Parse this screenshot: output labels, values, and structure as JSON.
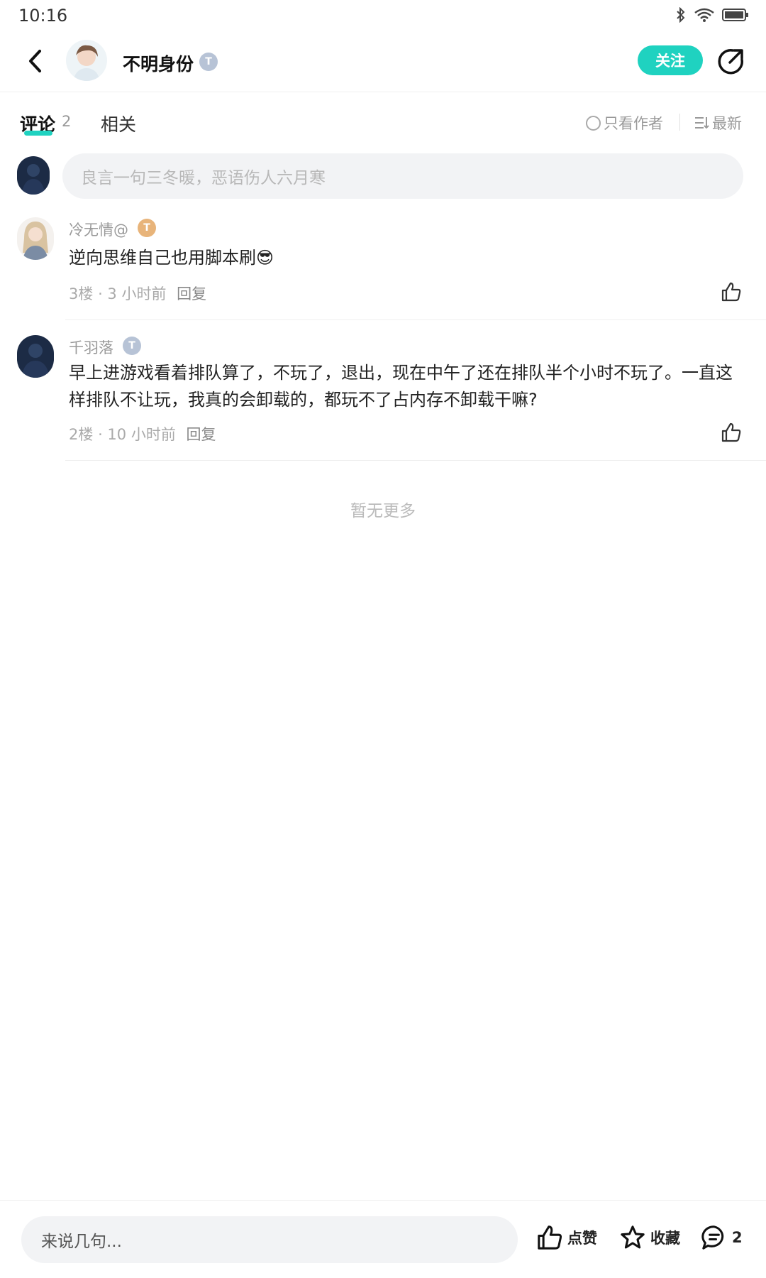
{
  "status_bar": {
    "time": "10:16",
    "icons": [
      "bluetooth-icon",
      "wifi-icon",
      "battery-icon"
    ]
  },
  "header": {
    "author_name": "不明身份",
    "level": "T",
    "follow_label": "关注",
    "accent": "#1fd2c0"
  },
  "tabs": {
    "comments_label": "评论",
    "comments_count": "2",
    "related_label": "相关",
    "only_author_label": "只看作者",
    "sort_label": "最新"
  },
  "comment_input": {
    "placeholder": "良言一句三冬暖，恶语伤人六月寒"
  },
  "comments": [
    {
      "name": "冷无情@",
      "level": "T",
      "text": "逆向思维自己也用脚本刷😎",
      "floor": "3楼",
      "time": "3 小时前",
      "reply_label": "回复"
    },
    {
      "name": "千羽落",
      "level": "T",
      "text": "早上进游戏看着排队算了，不玩了，退出，现在中午了还在排队半个小时不玩了。一直这样排队不让玩，我真的会卸载的，都玩不了占内存不卸载干嘛?",
      "floor": "2楼",
      "time": "10 小时前",
      "reply_label": "回复"
    }
  ],
  "no_more": "暂无更多",
  "bottom_bar": {
    "input_placeholder": "来说几句...",
    "like_label": "点赞",
    "collect_label": "收藏",
    "comment_count": "2"
  }
}
